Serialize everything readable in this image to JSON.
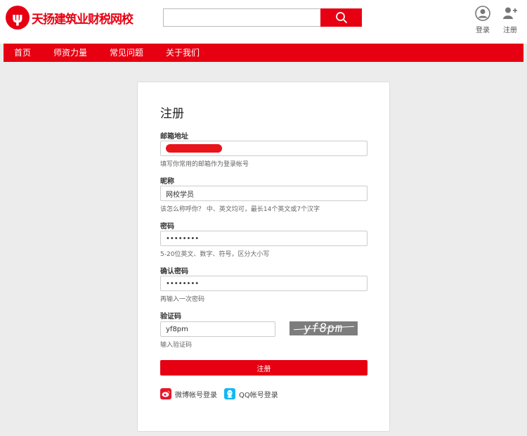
{
  "header": {
    "logo_mark": "ψ",
    "logo_text": "天扬建筑业财税网校",
    "search": {
      "value": "",
      "placeholder": ""
    },
    "login_label": "登录",
    "register_label": "注册"
  },
  "nav": [
    "首页",
    "师资力量",
    "常见问题",
    "关于我们"
  ],
  "form": {
    "title": "注册",
    "email": {
      "label": "邮箱地址",
      "value": "",
      "hint": "填写你常用的邮箱作为登录帐号"
    },
    "nickname": {
      "label": "昵称",
      "value": "网校学员",
      "hint": "该怎么称呼你？ 中、英文均可，最长14个英文或7个汉字"
    },
    "password": {
      "label": "密码",
      "value": "••••••••",
      "hint": "5-20位英文、数字、符号，区分大小写"
    },
    "confirm": {
      "label": "确认密码",
      "value": "••••••••",
      "hint": "再输入一次密码"
    },
    "captcha": {
      "label": "验证码",
      "value": "yf8pm",
      "image_text": "yf8pm",
      "hint": "输入验证码"
    },
    "submit_label": "注册",
    "weibo_label": "微博帐号登录",
    "qq_label": "QQ帐号登录"
  },
  "colors": {
    "brand_red": "#e60012",
    "weibo_red": "#e6162d",
    "qq_blue": "#12b7f5"
  },
  "icons": [
    "search-icon",
    "user-icon",
    "add-user-icon",
    "weibo-icon",
    "qq-icon"
  ]
}
